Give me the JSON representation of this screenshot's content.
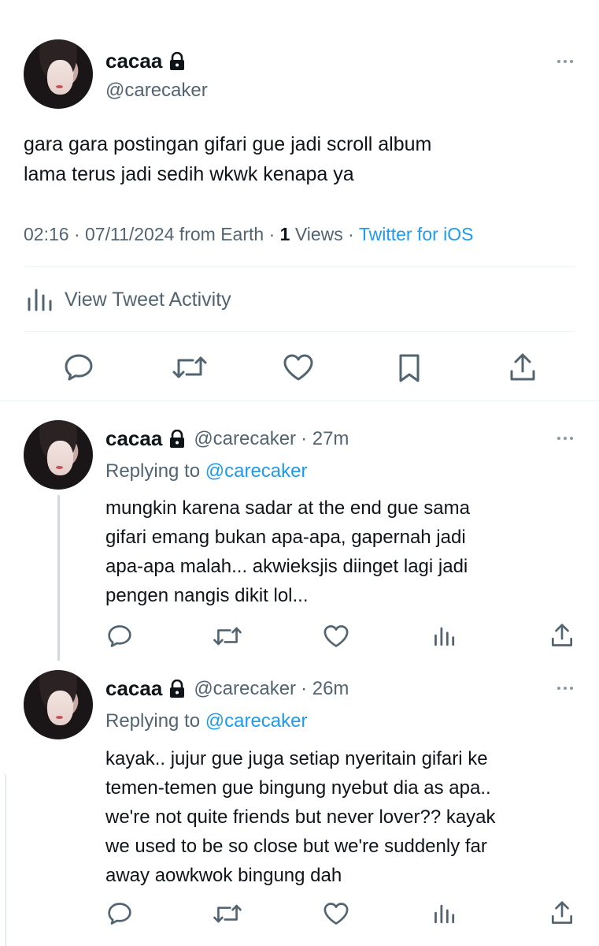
{
  "main_tweet": {
    "display_name": "cacaa",
    "handle": "@carecaker",
    "text_lines": [
      "gara gara postingan gifari gue jadi scroll album",
      "lama terus jadi sedih wkwk kenapa ya"
    ],
    "time": "02:16",
    "date": "07/11/2024 from Earth",
    "views_count": "1",
    "views_label": "Views",
    "source": "Twitter for iOS",
    "separator": "·",
    "activity_label": "View Tweet Activity"
  },
  "replies": [
    {
      "display_name": "cacaa",
      "handle": "@carecaker",
      "time": "· 27m",
      "replying_label": "Replying to",
      "replying_handle": "@carecaker",
      "text_lines": [
        "mungkin karena sadar at the end gue sama",
        "gifari emang bukan apa-apa, gapernah jadi",
        "apa-apa malah... akwieksjis diinget lagi jadi",
        "pengen nangis dikit lol..."
      ]
    },
    {
      "display_name": "cacaa",
      "handle": "@carecaker",
      "time": "· 26m",
      "replying_label": "Replying to",
      "replying_handle": "@carecaker",
      "text_lines": [
        "kayak.. jujur gue juga setiap nyeritain gifari ke",
        "temen-temen gue bingung nyebut dia as apa..",
        "we're not quite friends but never lover?? kayak",
        "we used to be so close but we're suddenly far",
        "away aowkwok bingung dah"
      ]
    }
  ],
  "icons": {
    "lock": "lock-icon",
    "more": "more-dots-icon",
    "reply": "comment-icon",
    "retweet": "retweet-icon",
    "like": "heart-icon",
    "bookmark": "bookmark-icon",
    "share": "share-icon",
    "analytics": "analytics-icon"
  },
  "colors": {
    "link": "#1d9bf0",
    "secondary_text": "#536471",
    "primary_text": "#0f1419"
  }
}
